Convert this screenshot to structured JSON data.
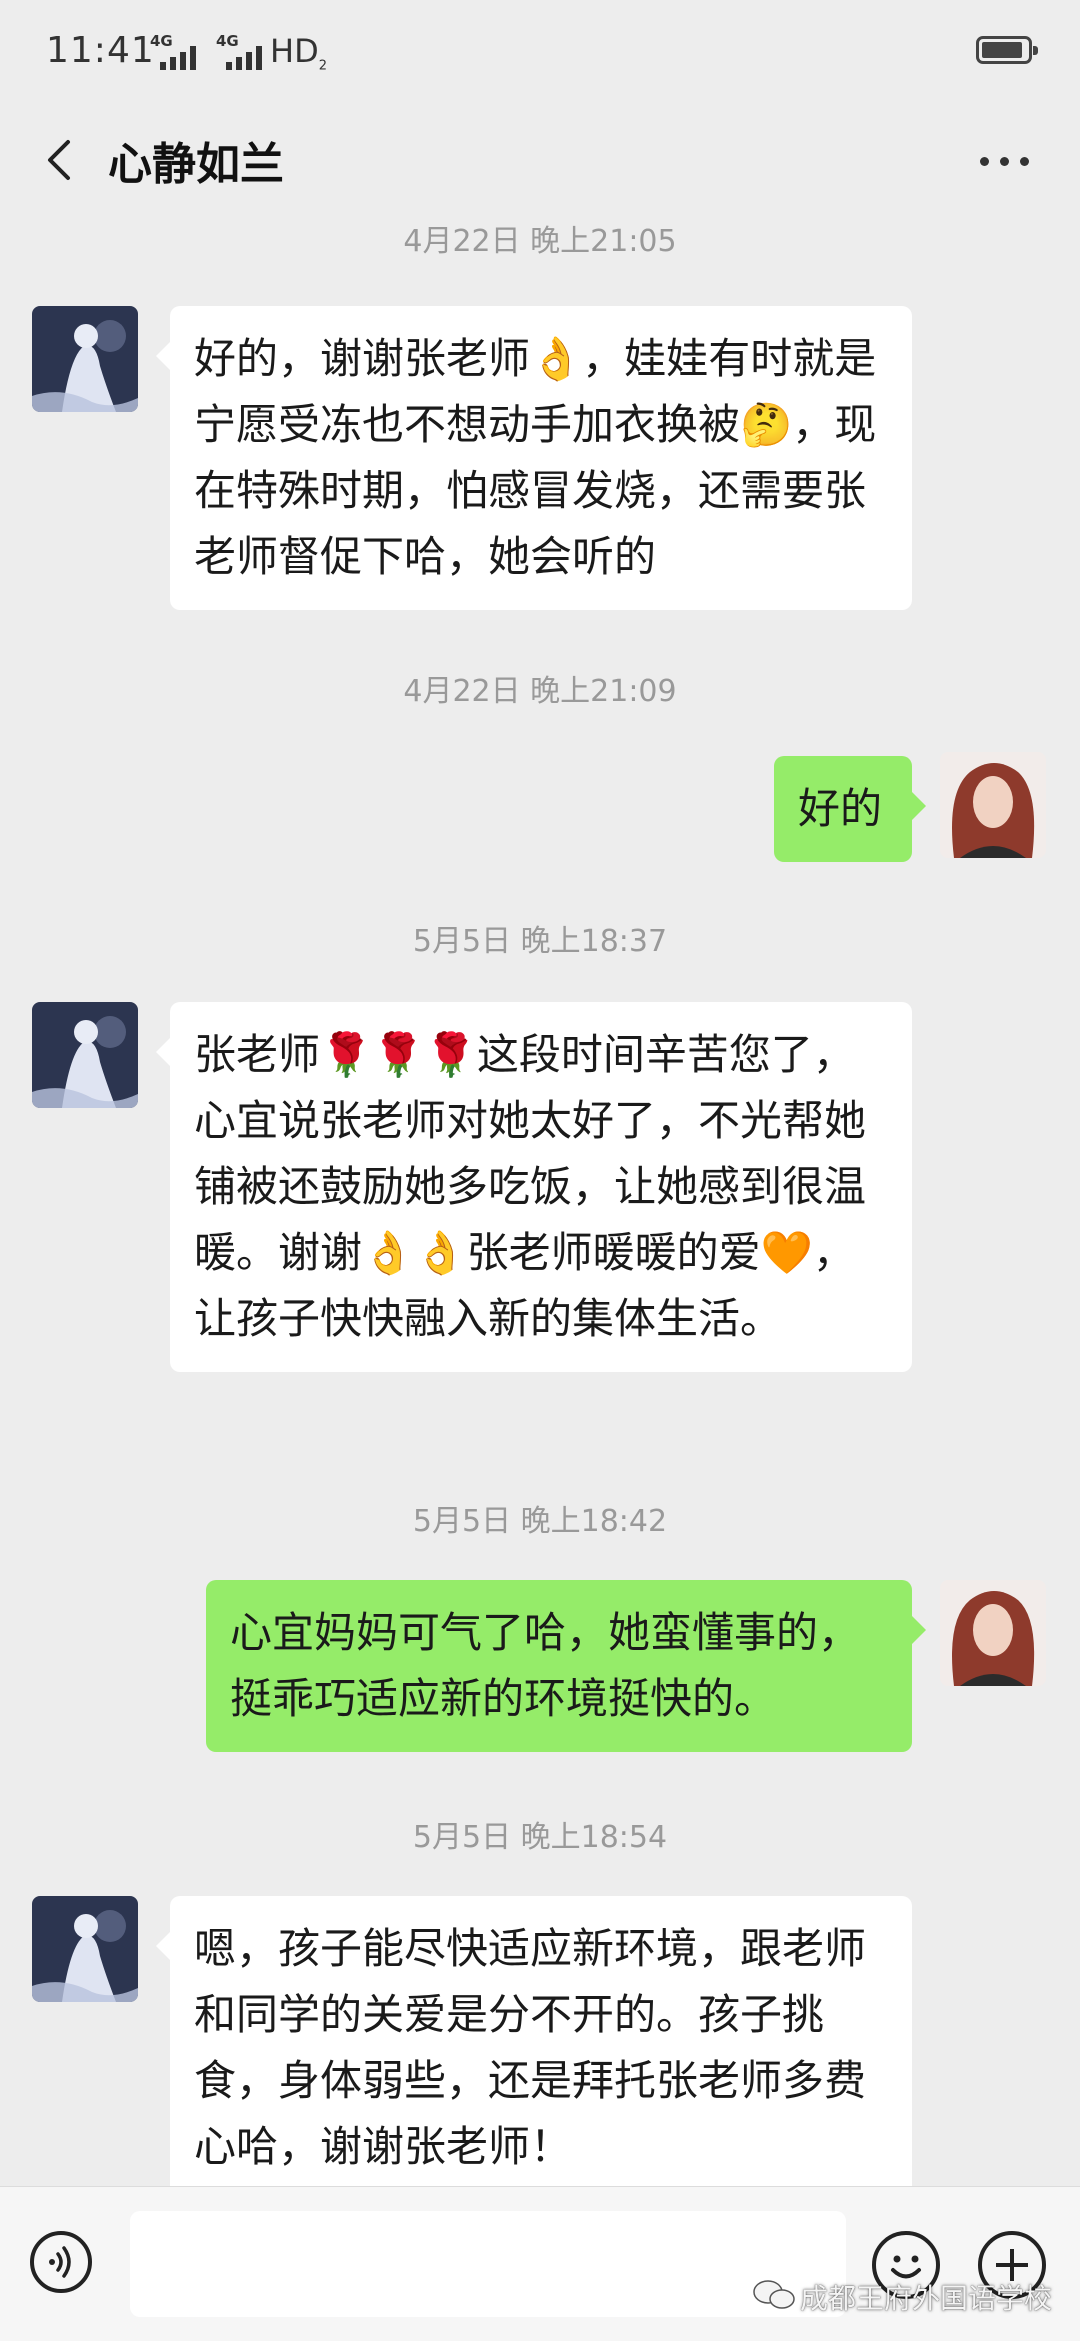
{
  "status_bar": {
    "time": "11:41",
    "signal_1_label": "4G",
    "signal_2_label": "4G",
    "hd_label": "HD",
    "hd_sub": "2",
    "battery_level": 0.9
  },
  "header": {
    "title": "心静如兰",
    "back_icon": "chevron-left-icon",
    "more_icon": "more-dots-icon"
  },
  "messages": {
    "ts1": "4月22日 晚上21:05",
    "m1": "好的，谢谢张老师👌，娃娃有时就是宁愿受冻也不想动手加衣换被🤔，现在特殊时期，怕感冒发烧，还需要张老师督促下哈，她会听的",
    "ts2": "4月22日 晚上21:09",
    "m2": "好的",
    "ts3": "5月5日 晚上18:37",
    "m3": "张老师🌹🌹🌹这段时间辛苦您了，心宜说张老师对她太好了，不光帮她铺被还鼓励她多吃饭，让她感到很温暖。谢谢👌👌张老师暖暖的爱🧡，让孩子快快融入新的集体生活。",
    "ts4": "5月5日 晚上18:42",
    "m4": "心宜妈妈可气了哈，她蛮懂事的，挺乖巧适应新的环境挺快的。",
    "ts5": "5月5日 晚上18:54",
    "m5": "嗯，孩子能尽快适应新环境，跟老师和同学的关爱是分不开的。孩子挑食，身体弱些，还是拜托张老师多费心哈，谢谢张老师！"
  },
  "input_bar": {
    "voice_icon": "voice-icon",
    "emoji_icon": "emoji-icon",
    "plus_icon": "plus-icon",
    "text_value": ""
  },
  "watermark": {
    "text": "成都王府外国语学校"
  },
  "colors": {
    "background": "#ededed",
    "incoming_bubble": "#ffffff",
    "outgoing_bubble": "#95ec69",
    "timestamp": "#999999"
  }
}
